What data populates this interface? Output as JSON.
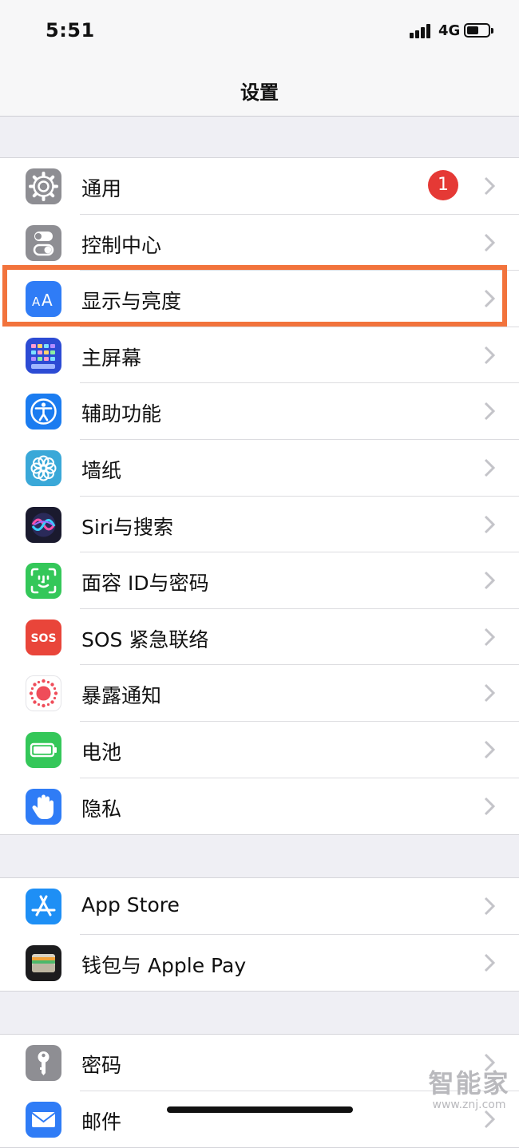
{
  "status_bar": {
    "time": "5:51",
    "network": "4G",
    "battery_level": 0.55
  },
  "nav": {
    "title": "设置"
  },
  "groups": [
    {
      "items": [
        {
          "label": "通用",
          "icon": "gear-icon",
          "icon_color": "#8e8e93",
          "badge": "1"
        },
        {
          "label": "控制中心",
          "icon": "toggles-icon",
          "icon_color": "#8e8e93"
        },
        {
          "label": "显示与亮度",
          "icon": "text-size-icon",
          "icon_color": "#2f7cf6"
        },
        {
          "label": "主屏幕",
          "icon": "home-grid-icon",
          "icon_color": "#2c4bd4"
        },
        {
          "label": "辅助功能",
          "icon": "accessibility-icon",
          "icon_color": "#1b7cf0"
        },
        {
          "label": "墙纸",
          "icon": "flower-icon",
          "icon_color": "#3aa8d8"
        },
        {
          "label": "Siri与搜索",
          "icon": "siri-icon",
          "icon_color": "#1a1a2e"
        },
        {
          "label": "面容 ID与密码",
          "icon": "face-id-icon",
          "icon_color": "#34c759"
        },
        {
          "label": "SOS 紧急联络",
          "icon": "sos-icon",
          "icon_color": "#e9453a"
        },
        {
          "label": "暴露通知",
          "icon": "exposure-icon",
          "icon_color": "#ffffff"
        },
        {
          "label": "电池",
          "icon": "battery-icon",
          "icon_color": "#34c759"
        },
        {
          "label": "隐私",
          "icon": "hand-icon",
          "icon_color": "#2f7cf6"
        }
      ]
    },
    {
      "items": [
        {
          "label": "App Store",
          "icon": "app-store-icon",
          "icon_color": "#1e8ff5"
        },
        {
          "label": "钱包与 Apple Pay",
          "icon": "wallet-icon",
          "icon_color": "#1c1c1e"
        }
      ]
    },
    {
      "items": [
        {
          "label": "密码",
          "icon": "key-icon",
          "icon_color": "#8e8e93"
        },
        {
          "label": "邮件",
          "icon": "mail-icon",
          "icon_color": "#2f7cf6"
        }
      ]
    }
  ],
  "watermark": {
    "main": "智能家",
    "sub": "www.znj.com"
  }
}
